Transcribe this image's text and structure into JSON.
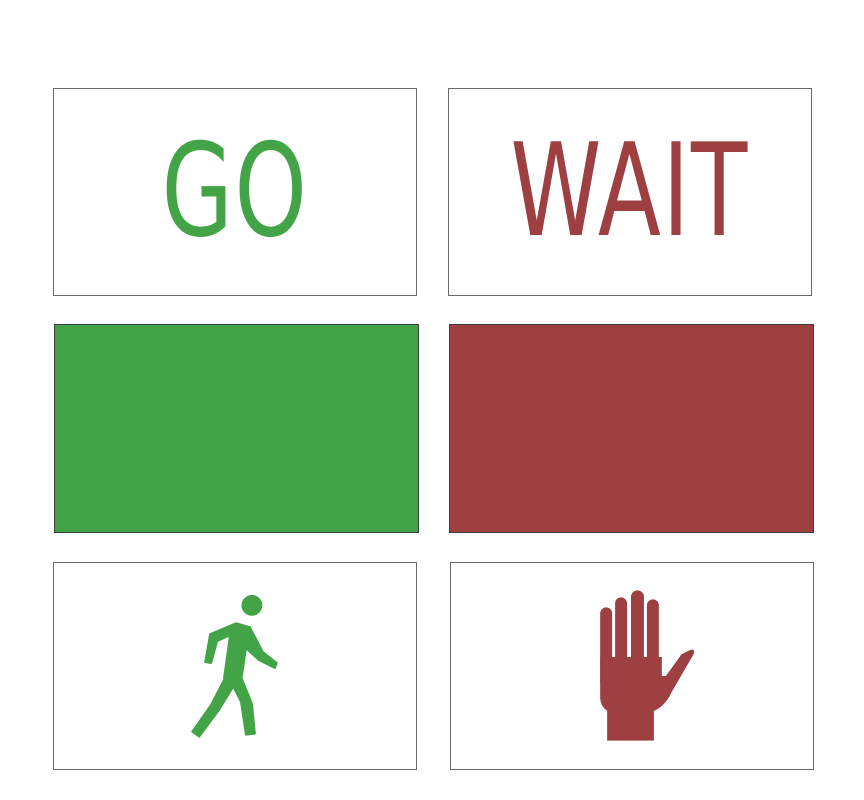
{
  "signs": {
    "go": {
      "label": "GO",
      "color": "#43a447",
      "icon": "walking-person-icon"
    },
    "wait": {
      "label": "WAIT",
      "color": "#9e4041",
      "icon": "raised-hand-icon"
    }
  }
}
